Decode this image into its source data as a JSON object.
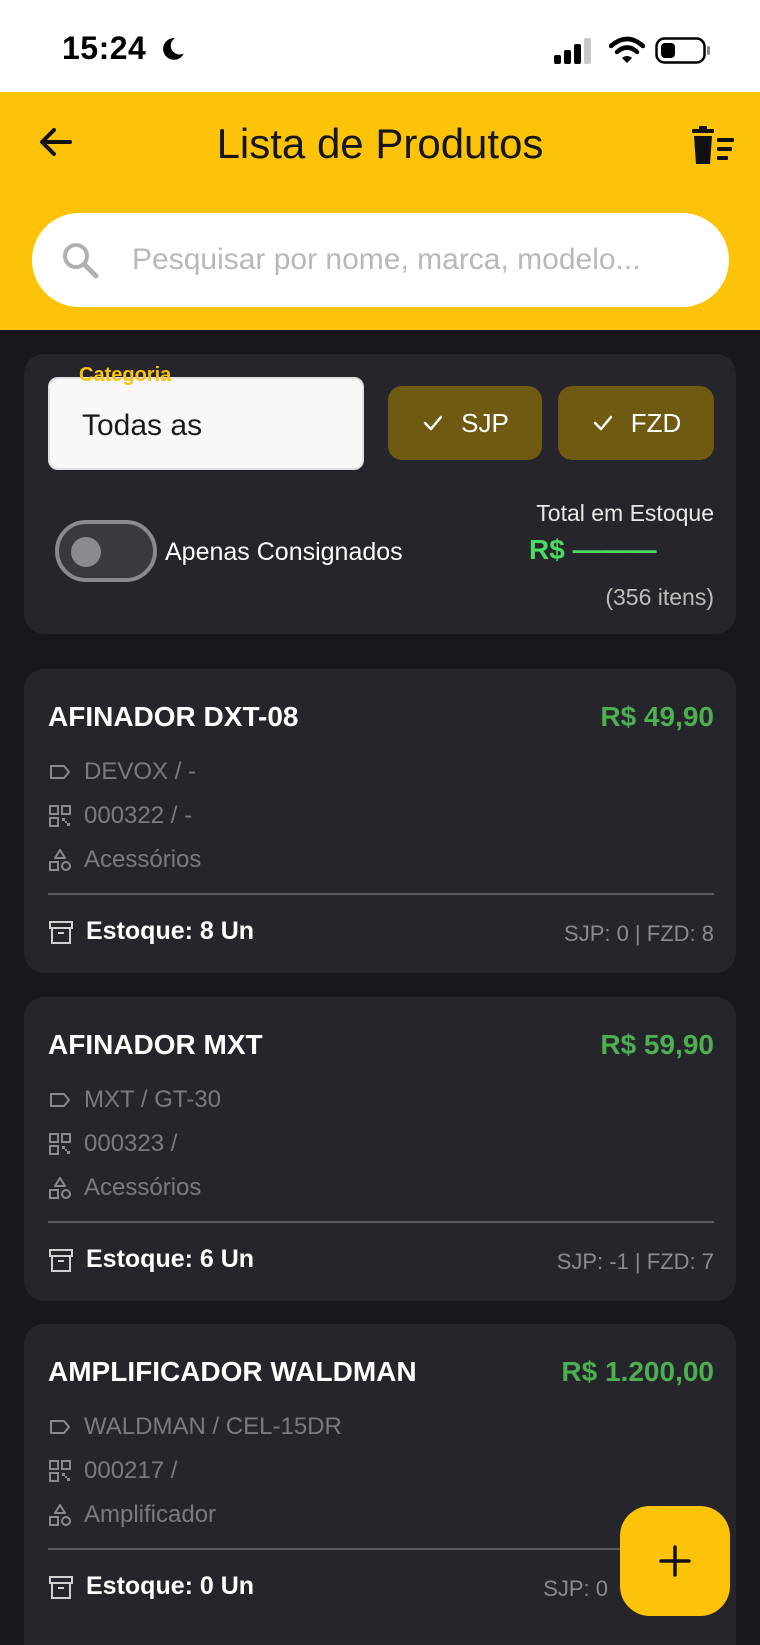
{
  "status_bar": {
    "time": "15:24"
  },
  "header": {
    "title": "Lista de Produtos",
    "back_icon": "arrow-left-icon",
    "trash_icon": "trash-list-icon"
  },
  "search": {
    "placeholder": "Pesquisar por nome, marca, modelo...",
    "value": ""
  },
  "filters": {
    "category_label": "Categoria",
    "category_value": "Todas as",
    "chips": [
      {
        "label": "SJP",
        "selected": true
      },
      {
        "label": "FZD",
        "selected": true
      }
    ],
    "consigned_label": "Apenas Consignados",
    "consigned_on": false,
    "total_label": "Total em Estoque",
    "total_value": "R$ ———",
    "total_count": "(356 itens)"
  },
  "products": [
    {
      "name": "AFINADOR DXT-08",
      "price": "R$ 49,90",
      "brand_model": "DEVOX / -",
      "code": "000322 / -",
      "category": "Acessórios",
      "stock": "Estoque: 8 Un",
      "split": "SJP: 0 | FZD: 8"
    },
    {
      "name": "AFINADOR MXT",
      "price": "R$ 59,90",
      "brand_model": "MXT / GT-30",
      "code": "000323 /",
      "category": "Acessórios",
      "stock": "Estoque: 6 Un",
      "split": "SJP: -1 | FZD: 7"
    },
    {
      "name": "AMPLIFICADOR WALDMAN",
      "price": "R$ 1.200,00",
      "brand_model": "WALDMAN / CEL-15DR",
      "code": "000217 /",
      "category": "Amplificador",
      "stock": "Estoque: 0 Un",
      "split": "SJP: 0"
    }
  ],
  "colors": {
    "accent": "#fcc309",
    "price_green": "#4caf50",
    "background": "#18171c",
    "card": "#26252b"
  }
}
